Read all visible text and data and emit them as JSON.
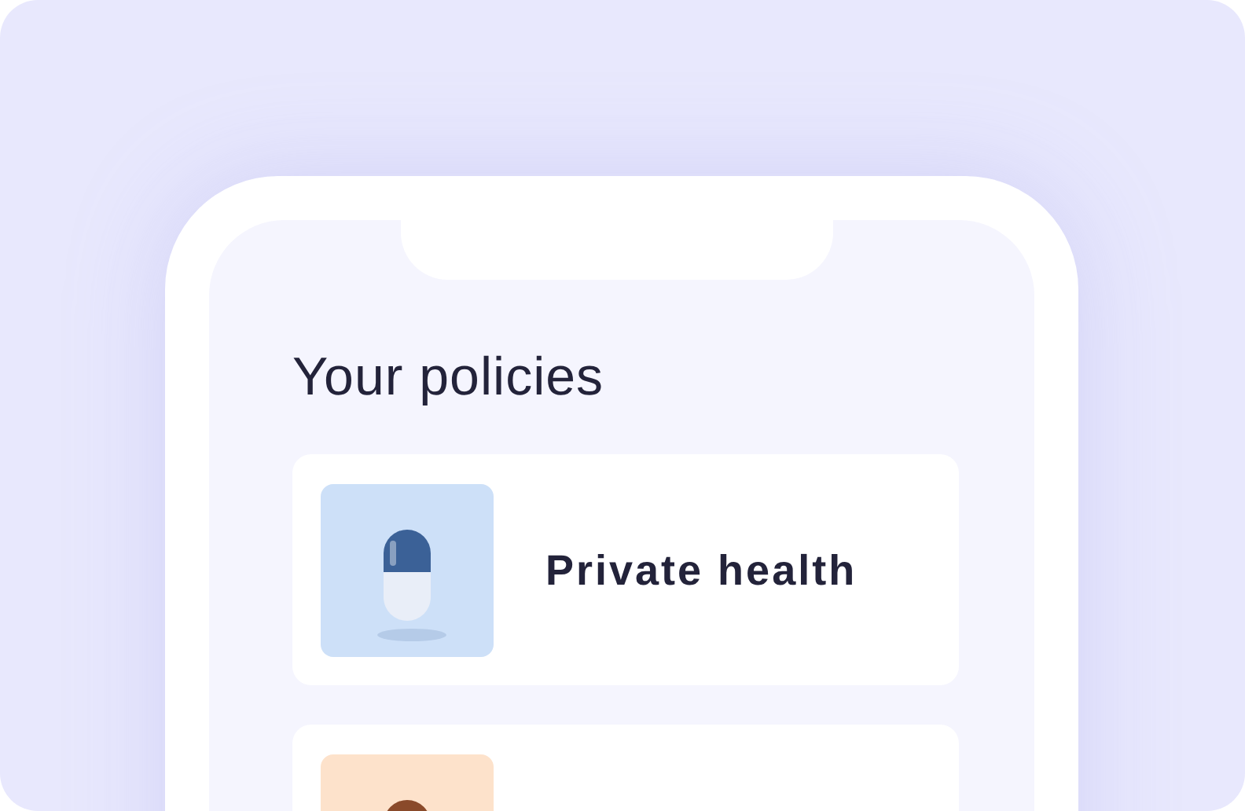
{
  "screen_title": "Your policies",
  "policies": [
    {
      "name": "Private health",
      "image": {
        "kind": "picture"
      }
    },
    {
      "image": {
        "kind": "picture"
      }
    }
  ]
}
